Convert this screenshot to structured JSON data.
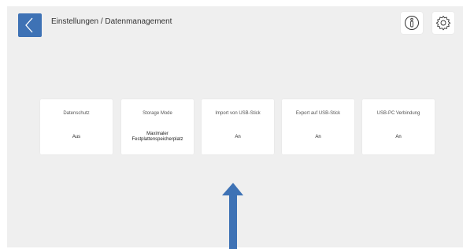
{
  "header": {
    "title": "Einstellungen / Datenmanagement",
    "back_icon": "chevron-left-icon",
    "info_icon": "info-icon",
    "settings_icon": "gear-icon",
    "accent_color": "#3e72b5"
  },
  "tiles": [
    {
      "label": "Datenschutz",
      "value": "Aus"
    },
    {
      "label": "Storage Mode",
      "value_line1": "Maximaler",
      "value_line2": "Festplattenspeicherplatz"
    },
    {
      "label": "Import von USB-Stick",
      "value": "An"
    },
    {
      "label": "Export auf USB-Stick",
      "value": "An"
    },
    {
      "label": "USB-PC Verbindung",
      "value": "An"
    }
  ],
  "annotation": {
    "arrow_icon": "up-arrow-icon",
    "arrow_color": "#3e72b5"
  }
}
